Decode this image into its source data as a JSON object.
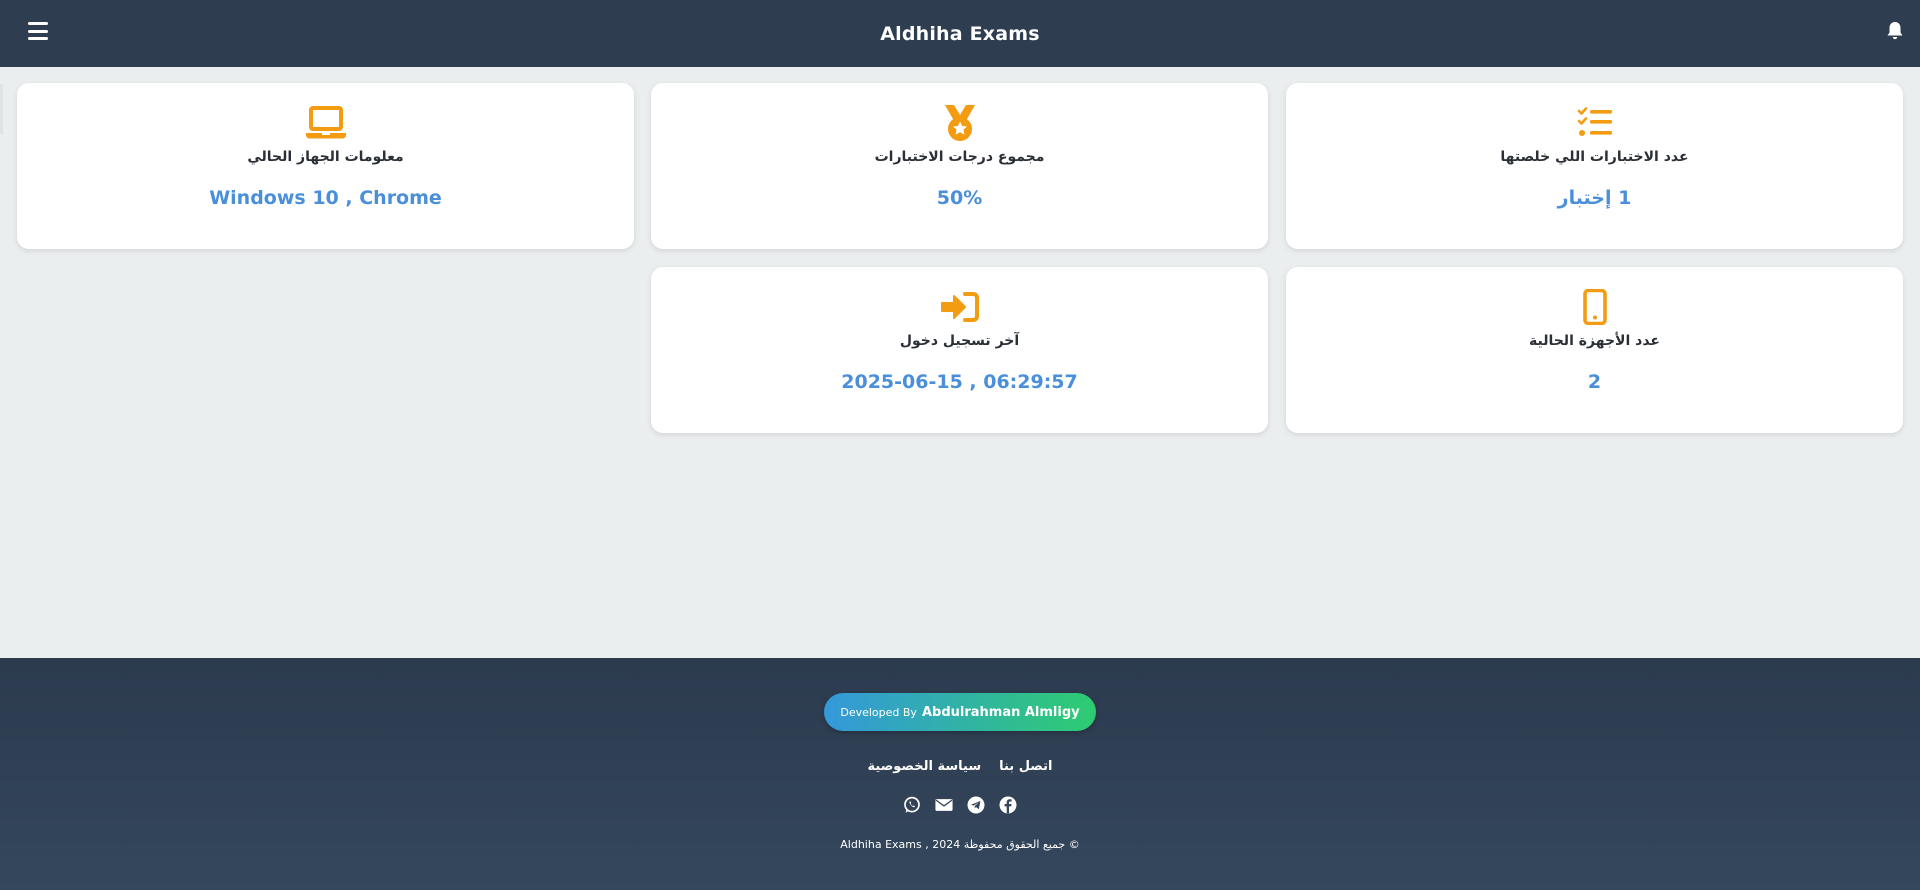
{
  "header": {
    "title": "Aldhiha Exams",
    "menu_icon": "hamburger-menu-icon",
    "notification_icon": "bell-icon"
  },
  "stats": [
    {
      "icon": "tasks-list-icon",
      "label": "عدد الاختبارات اللي خلصتها",
      "value": "1 إختبار"
    },
    {
      "icon": "medal-icon",
      "label": "مجموع درجات الاختبارات",
      "value": "50%"
    },
    {
      "icon": "laptop-icon",
      "label": "معلومات الجهاز الحالي",
      "value": "Windows 10 , Chrome"
    },
    {
      "icon": "mobile-phone-icon",
      "label": "عدد الأجهزة الحالية",
      "value": "2"
    },
    {
      "icon": "sign-in-icon",
      "label": "آخر تسجيل دخول",
      "value": "2025-06-15 , 06:29:57"
    }
  ],
  "footer": {
    "developer_prefix": "Developed By",
    "developer_name": "Abdulrahman Almligy",
    "links": [
      "اتصل بنا",
      "سياسة الخصوصية"
    ],
    "social_icons": [
      "whatsapp-icon",
      "email-icon",
      "telegram-icon",
      "facebook-icon"
    ],
    "copyright": "© جميع الحقوق محفوظة 2024 , Aldhiha Exams"
  },
  "colors": {
    "header_bg": "#2e3e50",
    "accent_icon": "#f39c12",
    "value_text": "#4a8fd9",
    "page_bg": "#ebeeef",
    "badge_gradient_start": "#3498db",
    "badge_gradient_end": "#2ecc71"
  }
}
